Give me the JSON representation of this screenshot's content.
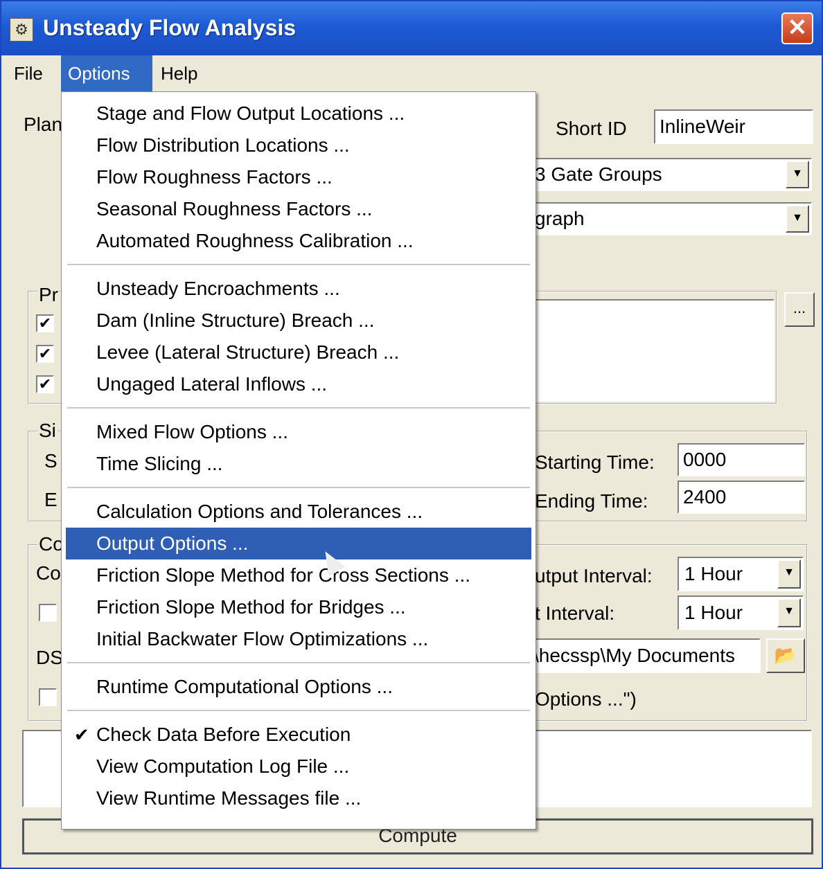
{
  "window": {
    "title": "Unsteady Flow Analysis",
    "icon": "hec-ras-icon",
    "close_icon": "close-icon"
  },
  "menubar": [
    "File",
    "Options",
    "Help"
  ],
  "background": {
    "plan_label": "Plan",
    "short_id_label": "Short ID",
    "short_id_value": "InlineWeir",
    "geometry_value": "3 Gate Groups",
    "flow_value": "graph",
    "programs_group_label": "Pr",
    "simulation_group_label": "Si",
    "start_label": "S",
    "end_label": "E",
    "starting_time_label": "Starting Time:",
    "starting_time_value": "0000",
    "ending_time_label": "Ending Time:",
    "ending_time_value": "2400",
    "computation_group_label": "Co",
    "computation_label": "Co",
    "output_interval_label": "utput Interval:",
    "output_interval_value": "1 Hour",
    "interval2_label": "t Interval:",
    "interval2_value": "1 Hour",
    "dss_label": "DS",
    "dss_path_value": "\\hecssp\\My Documents",
    "options_hint": "Options ...\")",
    "ellipsis_button": "...",
    "compute_button": "Compute"
  },
  "options_menu": {
    "groups": [
      [
        "Stage and Flow Output Locations ...",
        "Flow Distribution Locations ...",
        "Flow Roughness Factors ...",
        "Seasonal Roughness Factors ...",
        "Automated Roughness Calibration ..."
      ],
      [
        "Unsteady Encroachments ...",
        "Dam (Inline Structure) Breach ...",
        "Levee (Lateral Structure) Breach ...",
        "Ungaged Lateral Inflows ..."
      ],
      [
        "Mixed Flow Options ...",
        "Time Slicing ..."
      ],
      [
        "Calculation Options and Tolerances ...",
        "Output Options ...",
        "Friction Slope Method for Cross Sections ...",
        "Friction Slope Method for Bridges ...",
        "Initial Backwater Flow Optimizations ..."
      ],
      [
        "Runtime Computational Options ..."
      ],
      [
        "Check Data Before Execution",
        "View Computation Log File ...",
        "View Runtime Messages file ..."
      ]
    ],
    "highlighted": "Output Options ...",
    "checked": "Check Data Before Execution"
  }
}
